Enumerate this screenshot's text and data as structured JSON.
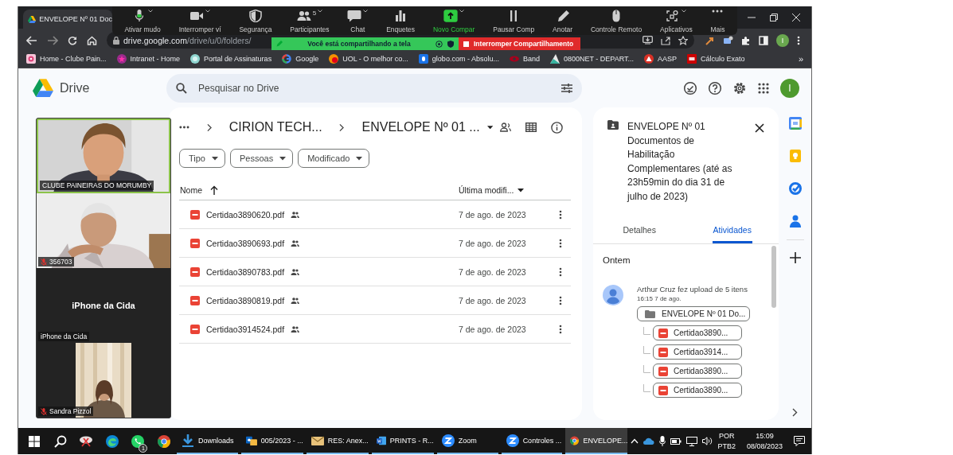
{
  "browser": {
    "tab": {
      "title": "ENVELOPE Nº 01 Doc",
      "selected": true
    },
    "address": {
      "host": "drive.google.com",
      "path": "/drive/u/0/folders/"
    },
    "profile": "I",
    "bookmarks": [
      {
        "label": "Home - Clube Pain..."
      },
      {
        "label": "Intranet - Home"
      },
      {
        "label": "Portal de Assinaturas"
      },
      {
        "label": "Google"
      },
      {
        "label": "UOL - O melhor co..."
      },
      {
        "label": "globo.com - Absolu..."
      },
      {
        "label": "Band"
      },
      {
        "label": "0800NET - DEPART..."
      },
      {
        "label": "AASP"
      },
      {
        "label": "Cálculo Exato"
      }
    ],
    "bookmarks_more": "»"
  },
  "meeting_toolbar": {
    "items": [
      {
        "label": "Ativar mudo",
        "menu": true,
        "active": false
      },
      {
        "label": "Interromper ví",
        "menu": true,
        "active": false
      },
      {
        "label": "Segurança",
        "menu": false,
        "active": false
      },
      {
        "label": "Participantes",
        "menu": true,
        "active": false,
        "badge": "5"
      },
      {
        "label": "Chat",
        "menu": true,
        "active": false
      },
      {
        "label": "Enquetes",
        "menu": false,
        "active": false
      },
      {
        "label": "Novo Compar",
        "menu": true,
        "active": true
      },
      {
        "label": "Pausar Comp",
        "menu": false,
        "active": false
      },
      {
        "label": "Anotar",
        "menu": false,
        "active": false
      },
      {
        "label": "Controle Remoto",
        "menu": false,
        "active": false
      },
      {
        "label": "Aplicativos",
        "menu": true,
        "active": false
      },
      {
        "label": "Mais",
        "menu": false,
        "active": false
      }
    ]
  },
  "share_banner": {
    "message": "Você está compartilhando a tela",
    "stop": "Interromper Compartilhamento"
  },
  "video_gallery": [
    {
      "name": "CLUBE PAINEIRAS DO MORUMBY",
      "kind": "video",
      "speaking": true,
      "muted": false
    },
    {
      "name": "356703",
      "kind": "video",
      "speaking": false,
      "muted": true
    },
    {
      "name": "iPhone da Cida",
      "kind": "no-video",
      "speaking": false,
      "muted": false,
      "display_name": "iPhone da Cida"
    },
    {
      "name": "Sandra Pizzol",
      "kind": "portrait-video",
      "speaking": false,
      "muted": true
    }
  ],
  "drive": {
    "app_name": "Drive",
    "search": {
      "placeholder": "Pesquisar no Drive"
    },
    "avatar": "I",
    "breadcrumb": [
      "CIRION TECH...",
      "ENVELOPE Nº 01 ..."
    ],
    "filters": [
      "Tipo",
      "Pessoas",
      "Modificado"
    ],
    "columns": [
      {
        "label": "Nome",
        "sorted": true
      },
      {
        "label": "Última modifi...",
        "sorted": false
      }
    ],
    "files": [
      {
        "name": "Certidao3890620.pdf",
        "shared": true,
        "modified": "7 de ago. de 2023"
      },
      {
        "name": "Certidao3890693.pdf",
        "shared": true,
        "modified": "7 de ago. de 2023"
      },
      {
        "name": "Certidao3890783.pdf",
        "shared": true,
        "modified": "7 de ago. de 2023"
      },
      {
        "name": "Certidao3890819.pdf",
        "shared": true,
        "modified": "7 de ago. de 2023"
      },
      {
        "name": "Certidao3914524.pdf",
        "shared": true,
        "modified": "7 de ago. de 2023"
      }
    ],
    "details": {
      "title": "ENVELOPE Nº 01 Documentos de Habilitação Complementares (até as 23h59min do dia 31 de julho de 2023)",
      "tabs": [
        {
          "label": "Detalhes",
          "selected": false
        },
        {
          "label": "Atividades",
          "selected": true
        }
      ],
      "group": "Ontem",
      "activity": {
        "text": "Arthur Cruz fez upload de 5 itens",
        "time": "16:15 7 de ago.",
        "folder": "ENVELOPE Nº 01 Do...",
        "files": [
          "Certidao3890...",
          "Certidao3914...",
          "Certidao3890...",
          "Certidao3890..."
        ]
      }
    }
  },
  "taskbar": {
    "whatsapp_badge": "1",
    "apps": [
      {
        "label": "Downloads",
        "selected": false
      },
      {
        "label": "005/2023 - ...",
        "selected": false
      },
      {
        "label": "RES: Anex...",
        "selected": false
      },
      {
        "label": "PRINTS - R...",
        "selected": false
      },
      {
        "label": "Zoom",
        "selected": false
      },
      {
        "label": "Controles ...",
        "selected": false
      },
      {
        "label": "ENVELOPE...",
        "selected": true
      }
    ],
    "language": "POR",
    "layout": "PTB2",
    "time": "15:09",
    "date": "08/08/2023"
  }
}
